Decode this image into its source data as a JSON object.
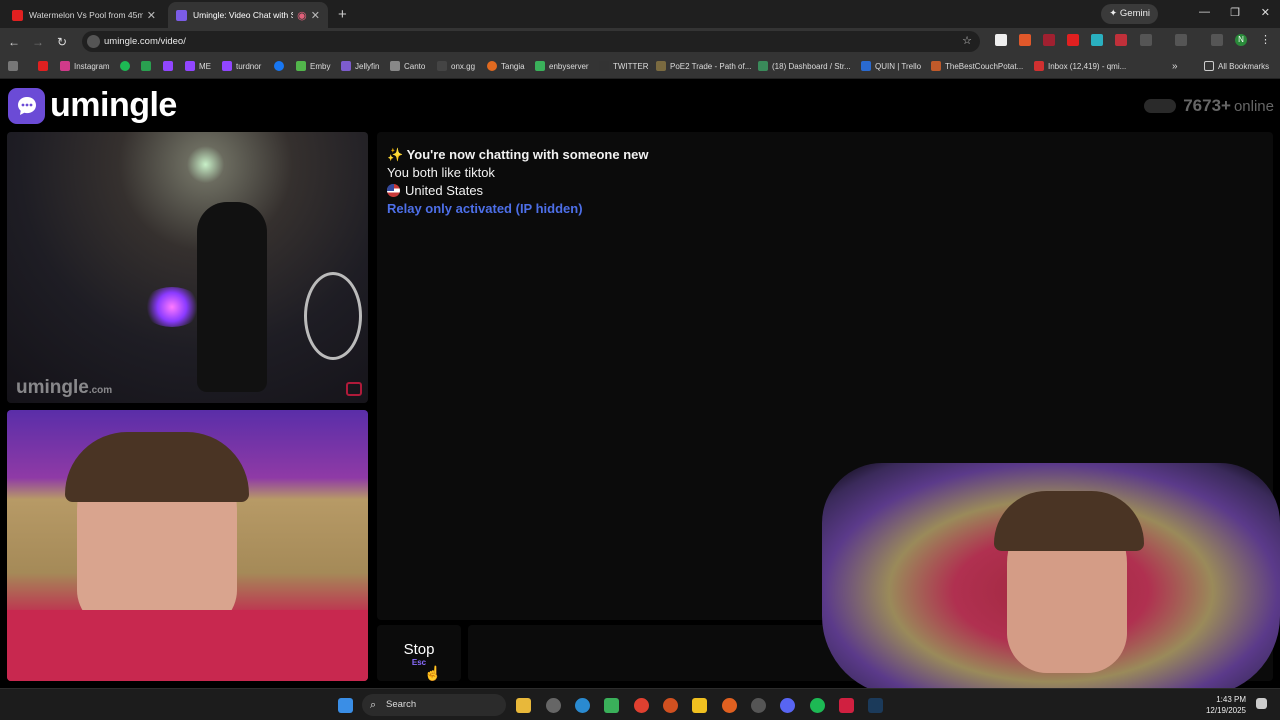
{
  "browser": {
    "tabs": [
      {
        "title": "Watermelon Vs Pool from 45m",
        "active": false
      },
      {
        "title": "Umingle: Video Chat with S",
        "active": true
      }
    ],
    "new_tab": "+",
    "gemini": "✦ Gemini",
    "url": "umingle.com/video/",
    "bookmarks": [
      "Instagram",
      "ME",
      "turdnor",
      "Emby",
      "Jellyfin",
      "Canto",
      "onx.gg",
      "Tangia",
      "enbyserver",
      "TWITTER",
      "PoE2 Trade - Path of...",
      "(18) Dashboard / Str...",
      "QUIN | Trello",
      "TheBestCouchPotat...",
      "Inbox (12,419) - qmi..."
    ],
    "all_bookmarks": "All Bookmarks",
    "profile_initial": "N"
  },
  "site": {
    "logo": "umingle",
    "online_count": "7673+",
    "online_label": "online"
  },
  "video": {
    "watermark": "umingle",
    "watermark_suffix": ".com"
  },
  "chat": {
    "line1": "✨ You're now chatting with someone new",
    "line2": "You both like tiktok",
    "line3": "United States",
    "line4": "Relay only activated (IP hidden)"
  },
  "controls": {
    "stop": "Stop",
    "stop_key": "Esc"
  },
  "taskbar": {
    "search": "Search",
    "time": "1:43 PM",
    "date": "12/19/2025"
  }
}
